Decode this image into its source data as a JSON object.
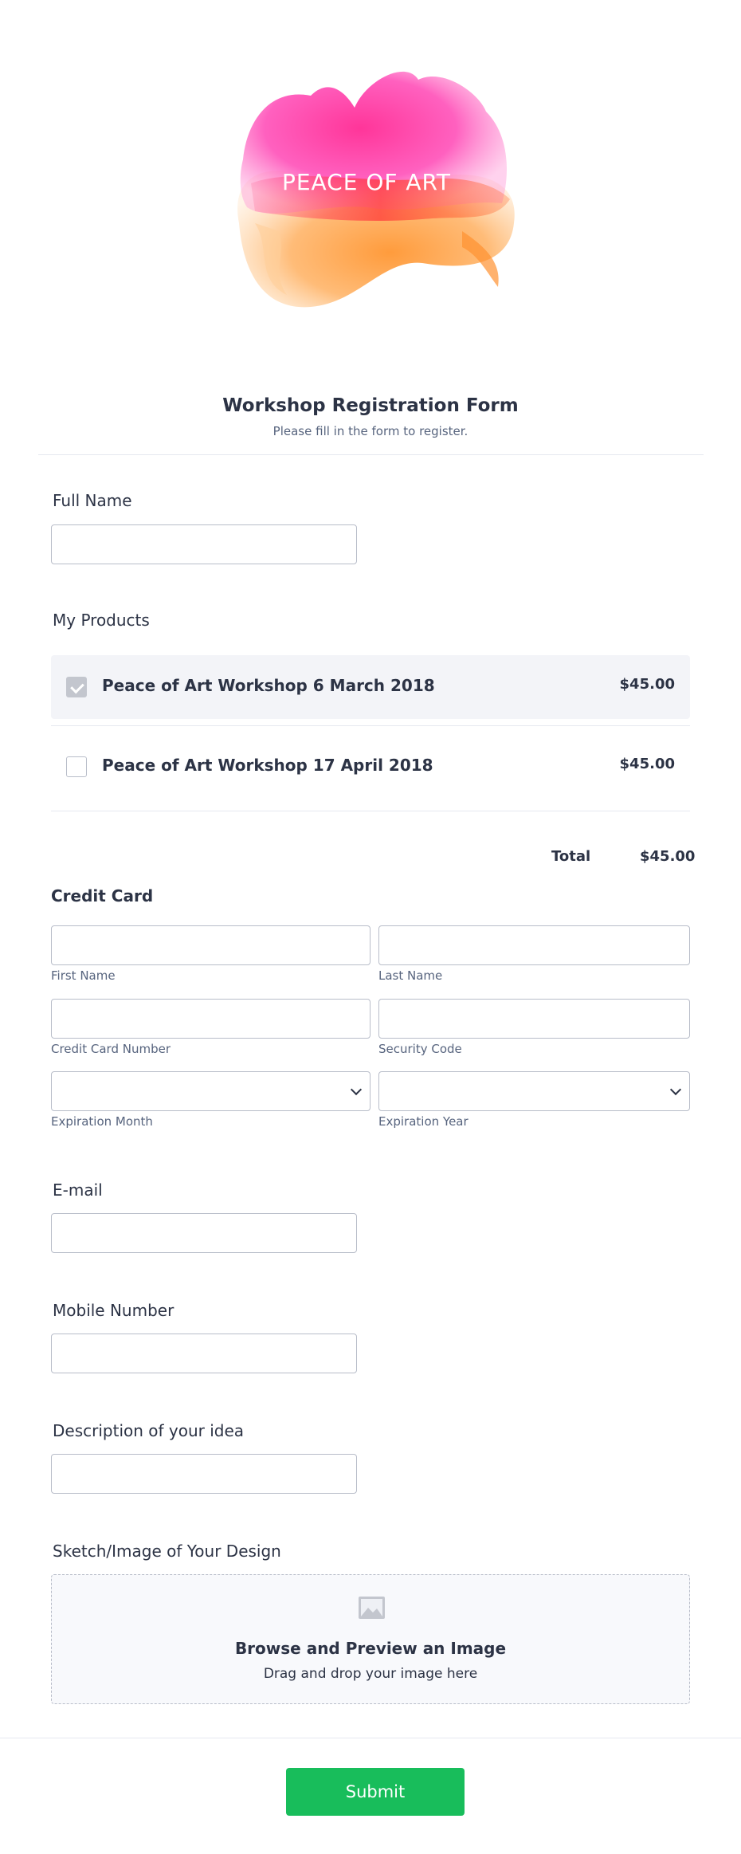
{
  "brand": {
    "logo_text": "PEACE OF ART"
  },
  "header": {
    "title": "Workshop Registration Form",
    "subtitle": "Please fill in the form to register."
  },
  "full_name": {
    "label": "Full Name",
    "value": ""
  },
  "products": {
    "label": "My Products",
    "items": [
      {
        "name": "Peace of Art Workshop 6 March 2018",
        "price": "$45.00",
        "selected": true
      },
      {
        "name": "Peace of Art Workshop 17 April 2018",
        "price": "$45.00",
        "selected": false
      }
    ],
    "total_label": "Total",
    "total_value": "$45.00"
  },
  "credit_card": {
    "title": "Credit Card",
    "first_name": "First Name",
    "last_name": "Last Name",
    "card_number": "Credit Card Number",
    "security_code": "Security Code",
    "exp_month": "Expiration Month",
    "exp_year": "Expiration Year"
  },
  "email": {
    "label": "E-mail",
    "value": ""
  },
  "mobile": {
    "label": "Mobile Number",
    "value": ""
  },
  "idea": {
    "label": "Description of your idea",
    "value": ""
  },
  "upload": {
    "label": "Sketch/Image of Your Design",
    "title": "Browse and Preview an Image",
    "subtitle": "Drag and drop your image here",
    "icon": "image-icon"
  },
  "submit_label": "Submit",
  "colors": {
    "accent": "#18bd5b",
    "text": "#2c3345",
    "muted": "#57647e"
  }
}
